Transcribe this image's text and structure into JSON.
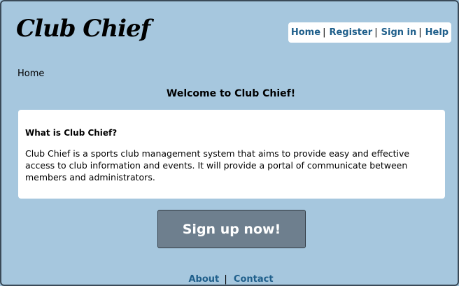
{
  "header": {
    "logo_text": "Club Chief"
  },
  "topnav": {
    "items": [
      {
        "label": "Home"
      },
      {
        "label": "Register"
      },
      {
        "label": "Sign in"
      },
      {
        "label": "Help"
      }
    ],
    "separator": "|"
  },
  "breadcrumb": "Home",
  "main": {
    "title": "Welcome to Club Chief!",
    "info_box": {
      "heading": "What is Club Chief?",
      "body": "Club Chief is a sports club management system that aims to provide easy and effective access to club information and events. It will provide a portal of communicate between members and administrators."
    },
    "signup_button": "Sign up now!"
  },
  "footer": {
    "links": [
      {
        "label": "About"
      },
      {
        "label": "Contact"
      }
    ],
    "separator": "|"
  },
  "colors": {
    "background": "#a6c7de",
    "link": "#1f5f8b",
    "button": "#6e7f8e"
  }
}
